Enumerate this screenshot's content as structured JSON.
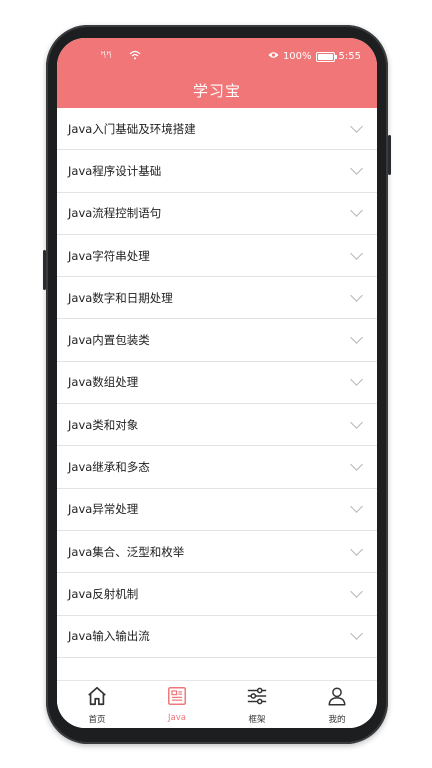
{
  "status_bar": {
    "signal": "ᴴₗ ᴴₗ",
    "battery": "100%",
    "battery_level": 1.0,
    "time": "5:55"
  },
  "header": {
    "title": "学习宝",
    "color": "#f07677"
  },
  "list": {
    "items": [
      {
        "label": "Java入门基础及环境搭建"
      },
      {
        "label": "Java程序设计基础"
      },
      {
        "label": "Java流程控制语句"
      },
      {
        "label": "Java字符串处理"
      },
      {
        "label": "Java数字和日期处理"
      },
      {
        "label": "Java内置包装类"
      },
      {
        "label": "Java数组处理"
      },
      {
        "label": "Java类和对象"
      },
      {
        "label": "Java继承和多态"
      },
      {
        "label": "Java异常处理"
      },
      {
        "label": "Java集合、泛型和枚举"
      },
      {
        "label": "Java反射机制"
      },
      {
        "label": "Java输入输出流"
      }
    ]
  },
  "tabbar": {
    "active_color": "#f07677",
    "tabs": [
      {
        "label": "首页",
        "icon": "home-icon"
      },
      {
        "label": "Java",
        "icon": "document-icon",
        "active": true
      },
      {
        "label": "框架",
        "icon": "sliders-icon"
      },
      {
        "label": "我的",
        "icon": "user-icon"
      }
    ]
  }
}
